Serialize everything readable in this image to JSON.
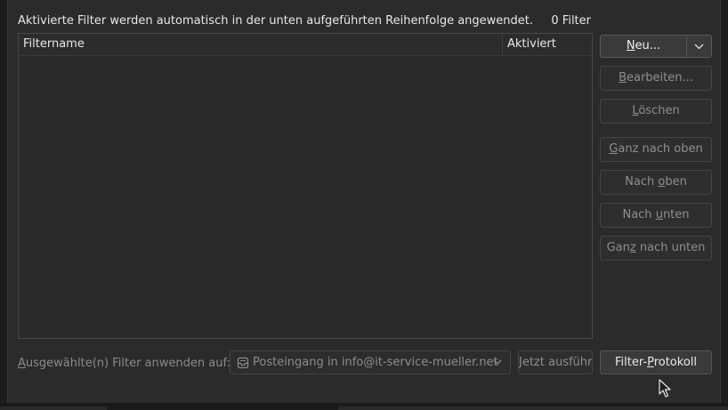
{
  "header": {
    "description": "Aktivierte Filter werden automatisch in der unten aufgeführten Reihenfolge angewendet.",
    "filter_count": "0 Filter"
  },
  "table": {
    "columns": [
      "Filtername",
      "Aktiviert"
    ],
    "rows": []
  },
  "buttons": {
    "new_pre": "",
    "new_ul": "N",
    "new_post": "eu...",
    "edit_pre": "",
    "edit_ul": "B",
    "edit_post": "earbeiten...",
    "delete_pre": "",
    "delete_ul": "L",
    "delete_post": "öschen",
    "top_pre": "",
    "top_ul": "G",
    "top_post": "anz nach oben",
    "up_pre": "Nach ",
    "up_ul": "o",
    "up_post": "ben",
    "down_pre": "Nach ",
    "down_ul": "u",
    "down_post": "nten",
    "bottom_pre": "Gan",
    "bottom_ul": "z",
    "bottom_post": " nach unten",
    "run_now": "Jetzt ausführen",
    "log_pre": "Filter-",
    "log_ul": "P",
    "log_post": "rotokoll"
  },
  "footer": {
    "apply_ul": "A",
    "apply_rest": "usgewählte(n) Filter anwenden auf:",
    "folder": "Posteingang in info@it-service-mueller.net"
  },
  "colors": {
    "background": "#2b2b2b",
    "disabled_text": "#8e8e8e",
    "enabled_text": "#eaeaea"
  },
  "icons": [
    "chevron-down-icon",
    "inbox-icon",
    "mouse-cursor-icon"
  ]
}
